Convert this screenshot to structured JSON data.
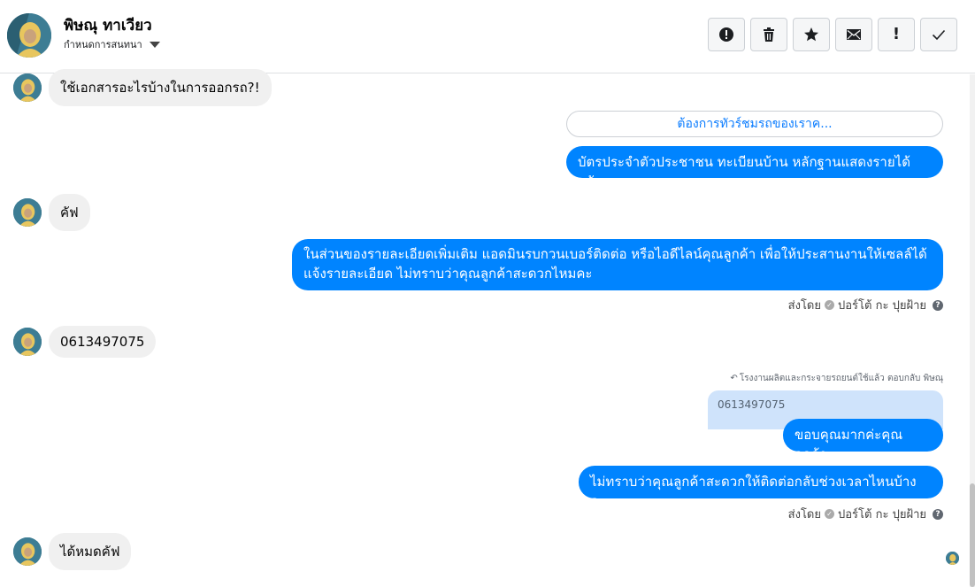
{
  "header": {
    "contact_name": "พิษณุ ทาเวียว",
    "subtitle": "กำหนดการสนทนา",
    "toolbar": [
      {
        "name": "report-spam-button",
        "icon": "alert-circle-icon"
      },
      {
        "name": "delete-button",
        "icon": "trash-icon"
      },
      {
        "name": "star-button",
        "icon": "star-icon"
      },
      {
        "name": "mark-unread-button",
        "icon": "envelope-icon"
      },
      {
        "name": "mark-important-button",
        "icon": "exclamation-icon"
      },
      {
        "name": "mark-done-button",
        "icon": "checkmark-icon"
      }
    ]
  },
  "messages": [
    {
      "direction": "in",
      "text": "ใช้เอกสารอะไรบ้างในการออกรถ?!"
    },
    {
      "direction": "out",
      "kind": "quick_reply",
      "text": "ต้องการทัวร์ชมรถของเราค..."
    },
    {
      "direction": "out",
      "text": "บัตรประจำตัวประชาชน ทะเบียนบ้าน หลักฐานแสดงรายได้ ครับ"
    },
    {
      "direction": "in",
      "text": "คัฟ"
    },
    {
      "direction": "out",
      "text": "ในส่วนของรายละเอียดเพิ่มเติม แอดมินรบกวนเบอร์ติดต่อ หรือไอดีไลน์คุณลูกค้า เพื่อให้ประสานงานให้เซลล์ได้แจ้งรายละเอียด ไม่ทราบว่าคุณลูกค้าสะดวกไหมคะ"
    },
    {
      "direction": "in",
      "text": "0613497075"
    },
    {
      "direction": "out",
      "text": "ขอบคุณมากค่ะคุณลูกค้า"
    },
    {
      "direction": "out",
      "text": "ไม่ทราบว่าคุณลูกค้าสะดวกให้ติดต่อกลับช่วงเวลาไหนบ้างคะ"
    },
    {
      "direction": "in",
      "text": "ได้หมดคัฟ"
    }
  ],
  "sent_by": {
    "prefix": "ส่งโดย",
    "name": "ปอร์โต้ กะ ปุยฝ้าย"
  },
  "reply_note": "โรงงานผลิตและกระจายรถยนต์ใช้แล้ว ตอบกลับ พิษณุ",
  "quoted_text": "0613497075"
}
